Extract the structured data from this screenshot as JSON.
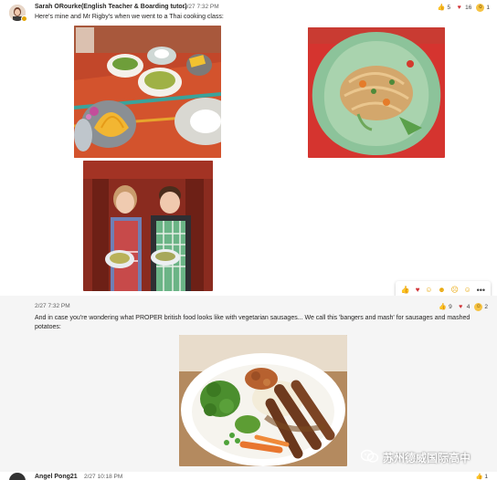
{
  "post1": {
    "author": "Sarah ORourke(English Teacher & Boarding tutor)",
    "timestamp": "2/27 7:32 PM",
    "message": "Here's mine and Mr Rigby's when we went to a Thai cooking class:",
    "reactions": [
      {
        "icon": "like-icon",
        "count": "5"
      },
      {
        "icon": "heart-icon",
        "count": "16"
      },
      {
        "icon": "surprised-icon",
        "count": "1"
      }
    ]
  },
  "post2": {
    "timestamp": "2/27 7:32 PM",
    "message": "And in case you're wondering what PROPER british food looks like with vegetarian sausages... We call this 'bangers and mash' for sausages and mashed potatoes:",
    "reactions": [
      {
        "icon": "like-icon",
        "count": "9"
      },
      {
        "icon": "heart-icon",
        "count": "4"
      },
      {
        "icon": "laugh-icon",
        "count": "2"
      }
    ]
  },
  "post3": {
    "author": "Angel Pong21",
    "timestamp": "2/27 10:18 PM",
    "reaction_count": "1"
  },
  "hover_bar": {
    "items": [
      "like-icon",
      "heart-icon",
      "laugh-icon",
      "surprised-icon",
      "sad-icon",
      "angry-icon",
      "more-options-icon"
    ],
    "more_label": "•••"
  },
  "watermark": {
    "text": "苏州德威国际高中"
  },
  "colors": {
    "like": "#e8a400",
    "heart": "#d13438",
    "background_post": "#ffffff",
    "background_alt": "#f5f5f5"
  }
}
